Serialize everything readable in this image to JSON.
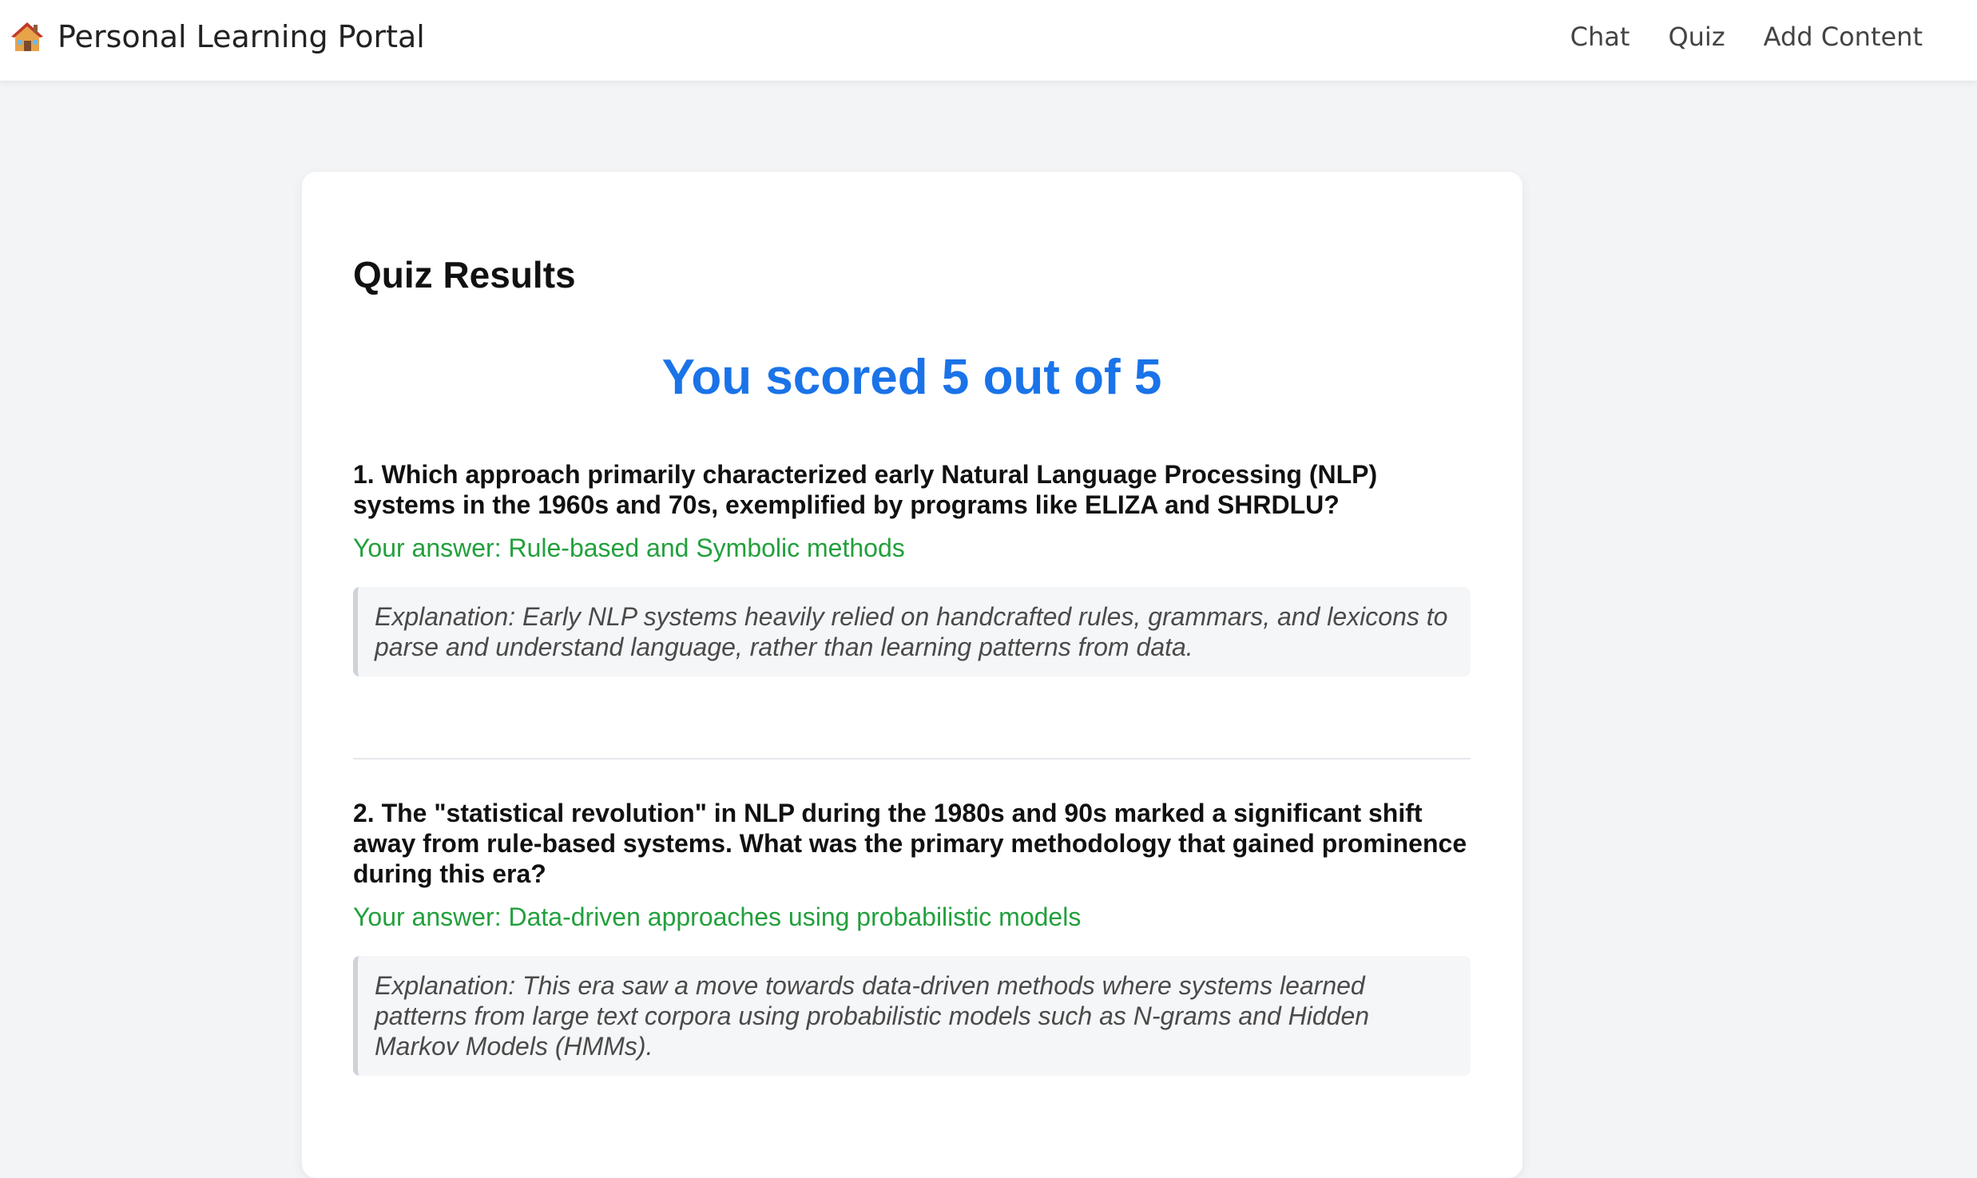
{
  "header": {
    "icon": "house-icon",
    "title": "Personal Learning Portal",
    "nav": [
      {
        "label": "Chat"
      },
      {
        "label": "Quiz"
      },
      {
        "label": "Add Content"
      }
    ]
  },
  "results": {
    "title": "Quiz Results",
    "score_text": "You scored 5 out of 5",
    "score": 5,
    "total": 5,
    "questions": [
      {
        "text": "1. Which approach primarily characterized early Natural Language Processing (NLP) systems in the 1960s and 70s, exemplified by programs like ELIZA and SHRDLU?",
        "answer": "Your answer: Rule-based and Symbolic methods",
        "explanation": "Explanation: Early NLP systems heavily relied on handcrafted rules, grammars, and lexicons to parse and understand language, rather than learning patterns from data."
      },
      {
        "text": "2. The \"statistical revolution\" in NLP during the 1980s and 90s marked a significant shift away from rule-based systems. What was the primary methodology that gained prominence during this era?",
        "answer": "Your answer: Data-driven approaches using probabilistic models",
        "explanation": "Explanation: This era saw a move towards data-driven methods where systems learned patterns from large text corpora using probabilistic models such as N-grams and Hidden Markov Models (HMMs)."
      }
    ]
  },
  "colors": {
    "accent": "#1a73e8",
    "correct": "#22a03c",
    "page_bg": "#f3f4f6"
  }
}
